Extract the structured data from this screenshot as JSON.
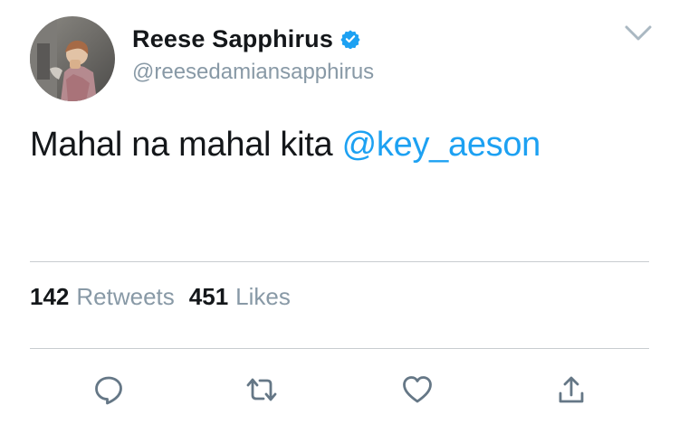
{
  "user": {
    "display_name": "Reese Sapphirus",
    "handle": "@reesedamiansapphirus",
    "verified": true
  },
  "tweet": {
    "text": "Mahal na mahal kita ",
    "mention": "@key_aeson"
  },
  "stats": {
    "retweets_count": "142",
    "retweets_label": "Retweets",
    "likes_count": "451",
    "likes_label": "Likes"
  },
  "icons": {
    "verified": "verified-badge-icon",
    "menu": "chevron-down-icon",
    "reply": "reply-icon",
    "retweet": "retweet-icon",
    "like": "heart-icon",
    "share": "share-icon"
  },
  "colors": {
    "text": "#14171a",
    "secondary": "#8899a6",
    "accent": "#1da1f2",
    "divider": "#c8ccd0"
  }
}
